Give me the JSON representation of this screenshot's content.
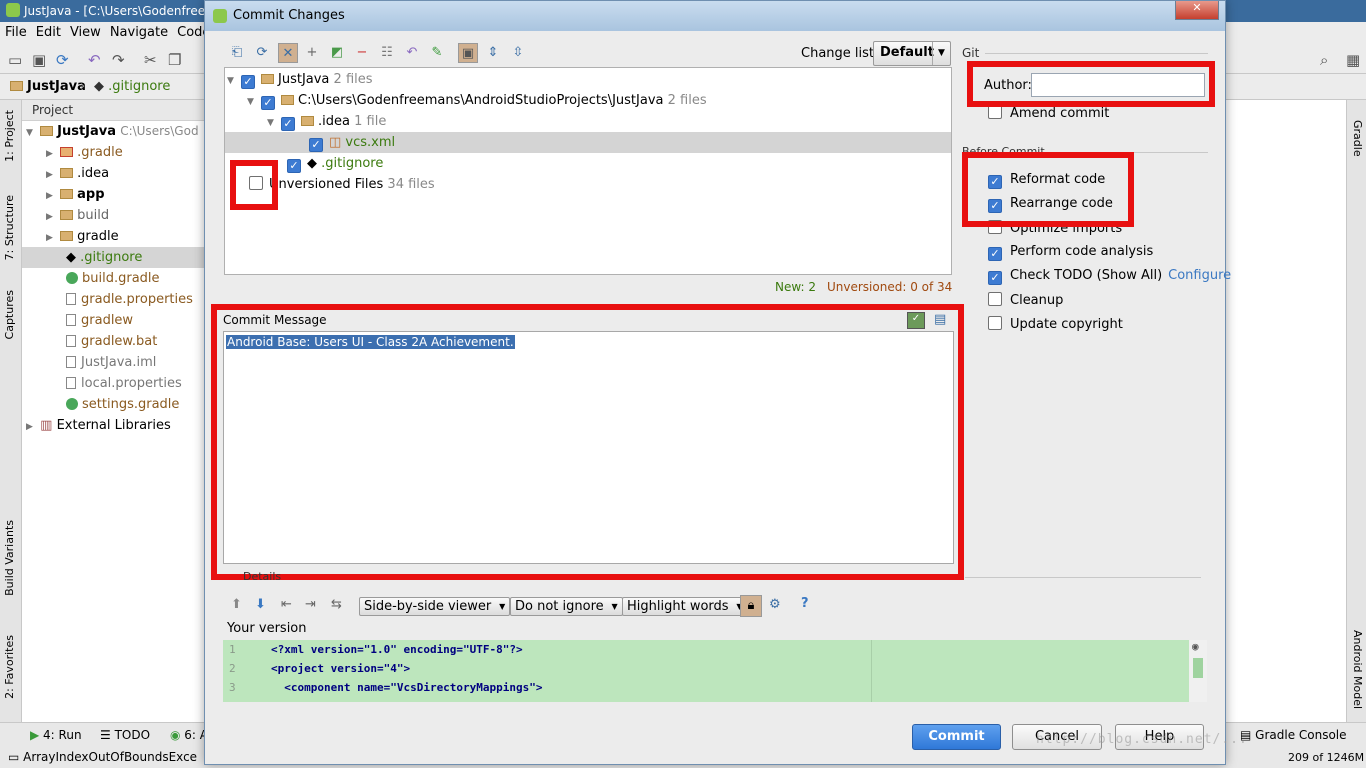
{
  "ide": {
    "title": "JustJava - [C:\\Users\\Godenfreem",
    "menu": [
      "File",
      "Edit",
      "View",
      "Navigate",
      "Code"
    ],
    "nav_crumbs": [
      "JustJava",
      ".gitignore"
    ],
    "project_header": "Project",
    "left_tabs": [
      "1: Project",
      "7: Structure",
      "Captures",
      "Build Variants",
      "2: Favorites"
    ],
    "right_tabs": [
      "Gradle",
      "Android Model"
    ],
    "tree": [
      {
        "label": "JustJava",
        "extra": "C:\\Users\\God",
        "bold": true
      },
      {
        "label": ".gradle"
      },
      {
        "label": ".idea"
      },
      {
        "label": "app",
        "bold": true
      },
      {
        "label": "build"
      },
      {
        "label": "gradle"
      },
      {
        "label": ".gitignore"
      },
      {
        "label": "build.gradle"
      },
      {
        "label": "gradle.properties"
      },
      {
        "label": "gradlew"
      },
      {
        "label": "gradlew.bat"
      },
      {
        "label": "JustJava.iml"
      },
      {
        "label": "local.properties"
      },
      {
        "label": "settings.gradle"
      },
      {
        "label": "External Libraries"
      }
    ],
    "status": {
      "run_tab": "4: Run",
      "todo_tab": "TODO",
      "android_tab": "6: A",
      "gradle_console": "Gradle Console",
      "message": "ArrayIndexOutOfBoundsExce",
      "memory": "209 of 1246M"
    }
  },
  "dialog": {
    "title": "Commit Changes",
    "changelist_label": "Change list:",
    "changelist_value": "Default",
    "tree": {
      "root": {
        "label": "JustJava",
        "count": "2 files"
      },
      "path": {
        "label": "C:\\Users\\Godenfreemans\\AndroidStudioProjects\\JustJava",
        "count": "2 files"
      },
      "idea": {
        "label": ".idea",
        "count": "1 file"
      },
      "vcs": {
        "label": "vcs.xml"
      },
      "gitignore": {
        "label": ".gitignore"
      },
      "unversioned": {
        "label": "Unversioned Files",
        "count": "34 files"
      }
    },
    "counts": {
      "new": "New: 2",
      "unversioned": "Unversioned: 0 of 34"
    },
    "commit_message_label": "Commit Message",
    "commit_message": "Android Base: Users UI - Class 2A Achievement.",
    "git_label": "Git",
    "author_label": "Author:",
    "author_value": "",
    "amend_commit": "Amend commit",
    "before_commit_label": "Before Commit",
    "options": [
      {
        "label": "Reformat code",
        "checked": true
      },
      {
        "label": "Rearrange code",
        "checked": true
      },
      {
        "label": "Optimize imports",
        "checked": false
      },
      {
        "label": "Perform code analysis",
        "checked": true
      },
      {
        "label": "Check TODO (Show All)",
        "checked": true
      },
      {
        "label": "Cleanup",
        "checked": false
      },
      {
        "label": "Update copyright",
        "checked": false
      }
    ],
    "configure_link": "Configure",
    "details_label": "Details",
    "diff_toolbar": {
      "viewer": "Side-by-side viewer",
      "ignore": "Do not ignore",
      "highlight": "Highlight words"
    },
    "your_version": "Your version",
    "diff_lines": [
      {
        "n": "1",
        "code": "<?xml version=\"1.0\" encoding=\"UTF-8\"?>"
      },
      {
        "n": "2",
        "code": "<project version=\"4\">"
      },
      {
        "n": "3",
        "code": "  <component name=\"VcsDirectoryMappings\">"
      }
    ],
    "buttons": {
      "commit": "Commit",
      "cancel": "Cancel",
      "help": "Help"
    },
    "watermark": "http://blog.csdn.net/..."
  }
}
